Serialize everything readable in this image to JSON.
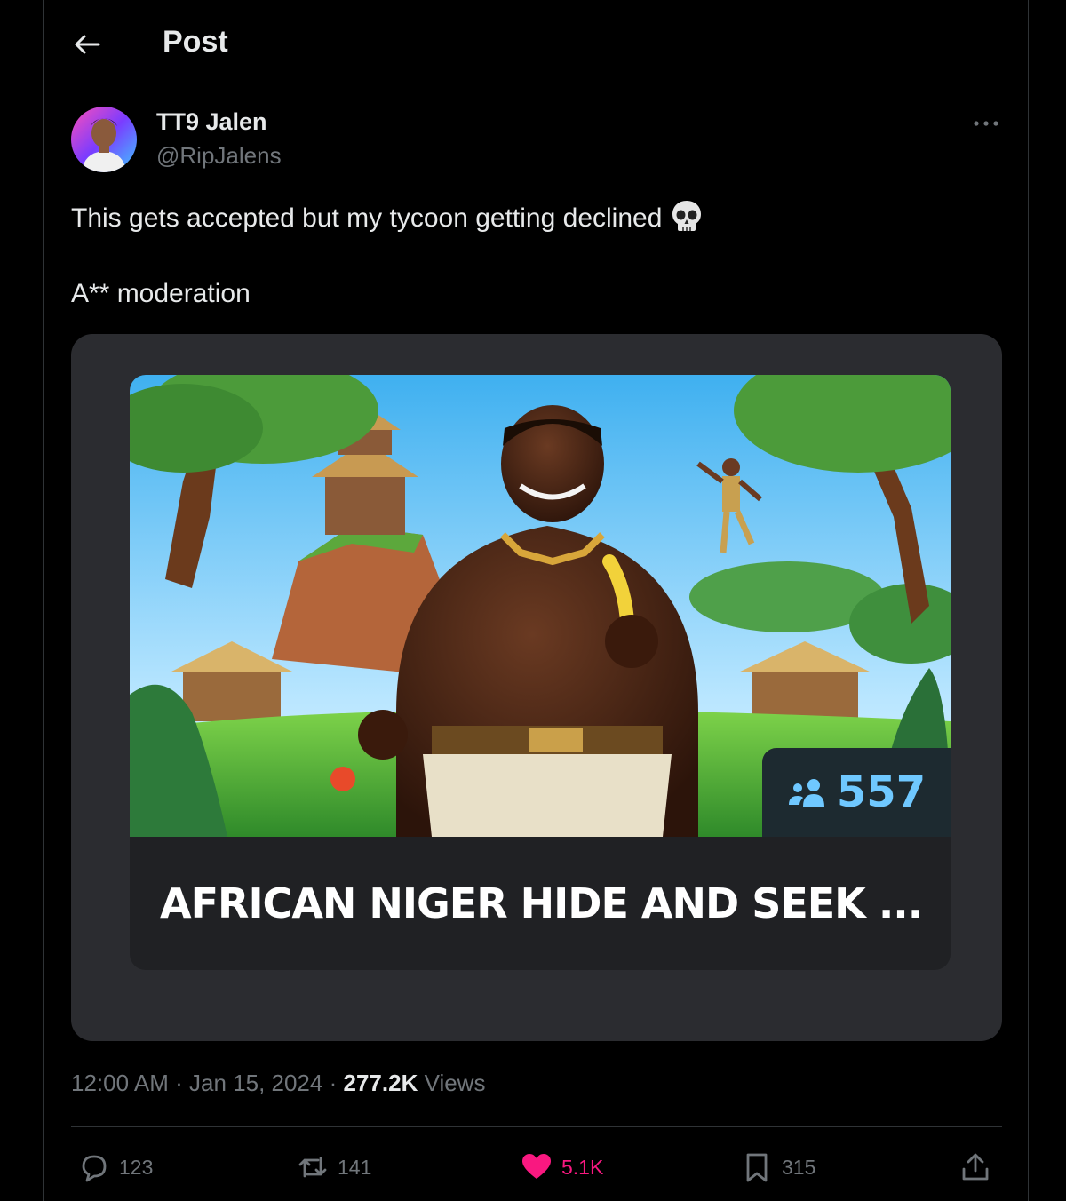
{
  "header": {
    "title": "Post"
  },
  "author": {
    "name": "TT9 Jalen",
    "handle": "@RipJalens"
  },
  "post": {
    "line1": "This gets accepted but my tycoon getting declined",
    "line1_emoji": "skull-icon",
    "line2": "A** moderation"
  },
  "card": {
    "players": "557",
    "title": "AFRICAN NIGER HIDE AND SEEK ..."
  },
  "meta": {
    "time": "12:00 AM",
    "separator": "·",
    "date": "Jan 15, 2024",
    "views_count": "277.2K",
    "views_label": "Views"
  },
  "actions": {
    "replies": "123",
    "reposts": "141",
    "likes": "5.1K",
    "bookmarks": "315"
  },
  "colors": {
    "background": "#000000",
    "text_primary": "#e7e9ea",
    "text_secondary": "#71767b",
    "like": "#f91880",
    "player_count": "#6fc8ff"
  }
}
